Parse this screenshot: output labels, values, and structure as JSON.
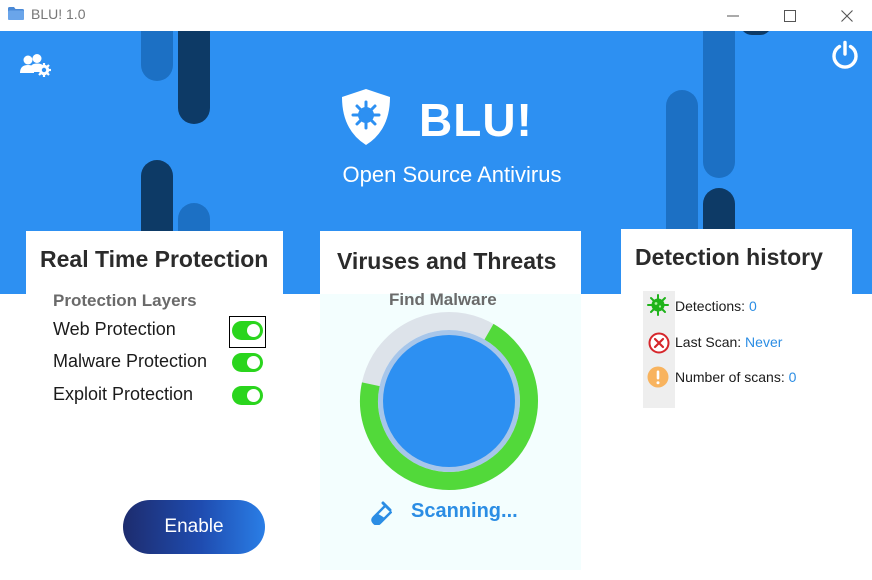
{
  "window": {
    "title": "BLU! 1.0"
  },
  "hero": {
    "brand_title": "BLU!",
    "brand_subtitle": "Open Source Antivirus",
    "icons": [
      "user-settings-icon",
      "power-icon",
      "shield-virus-icon"
    ]
  },
  "realtime": {
    "title": "Real Time Protection",
    "subtitle": "Protection Layers",
    "layers": [
      {
        "label": "Web Protection",
        "enabled": true
      },
      {
        "label": "Malware Protection",
        "enabled": true
      },
      {
        "label": "Exploit Protection",
        "enabled": true
      }
    ],
    "enable_button": "Enable"
  },
  "viruses": {
    "title": "Viruses and Threats",
    "subtitle": "Find Malware",
    "status": "Scanning...",
    "progress": 0.7
  },
  "history": {
    "title": "Detection history",
    "items": [
      {
        "label": "Detections:",
        "value": "0",
        "icon": "virus-icon"
      },
      {
        "label": "Last Scan:",
        "value": "Never",
        "icon": "error-icon"
      },
      {
        "label": "Number of scans:",
        "value": "0",
        "icon": "warning-icon"
      }
    ]
  },
  "colors": {
    "hero_blue": "#2d90f2",
    "toggle_green": "#2ad51d",
    "link_blue": "#2b8de4"
  }
}
